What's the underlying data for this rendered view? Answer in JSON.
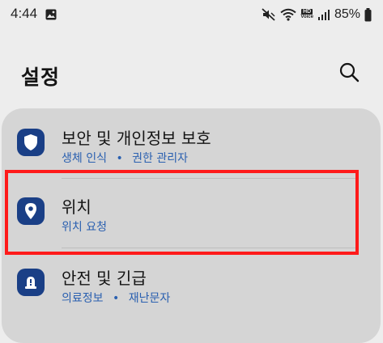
{
  "status_bar": {
    "time": "4:44",
    "battery": "85%",
    "hd_voice_top": "HD",
    "hd_voice_bottom": "Voice",
    "icons": [
      "gallery-icon",
      "mute-icon",
      "wifi-icon",
      "hd-voice-icon",
      "signal-icon",
      "battery-icon"
    ]
  },
  "header": {
    "title": "설정",
    "search_icon": "search-icon"
  },
  "settings": {
    "items": [
      {
        "title": "보안 및 개인정보 보호",
        "subtitle_a": "생체 인식",
        "separator": "•",
        "subtitle_b": "권한 관리자",
        "icon": "shield-icon"
      },
      {
        "title": "위치",
        "subtitle": "위치 요청",
        "icon": "location-pin-icon"
      },
      {
        "title": "안전 및 긴급",
        "subtitle_a": "의료정보",
        "separator": "•",
        "subtitle_b": "재난문자",
        "icon": "emergency-alert-icon"
      }
    ]
  },
  "colors": {
    "background": "#ededed",
    "card": "#d5d5d5",
    "icon_bg": "#1a3f86",
    "subtitle": "#2a60b0",
    "highlight": "#ff1a1a"
  }
}
